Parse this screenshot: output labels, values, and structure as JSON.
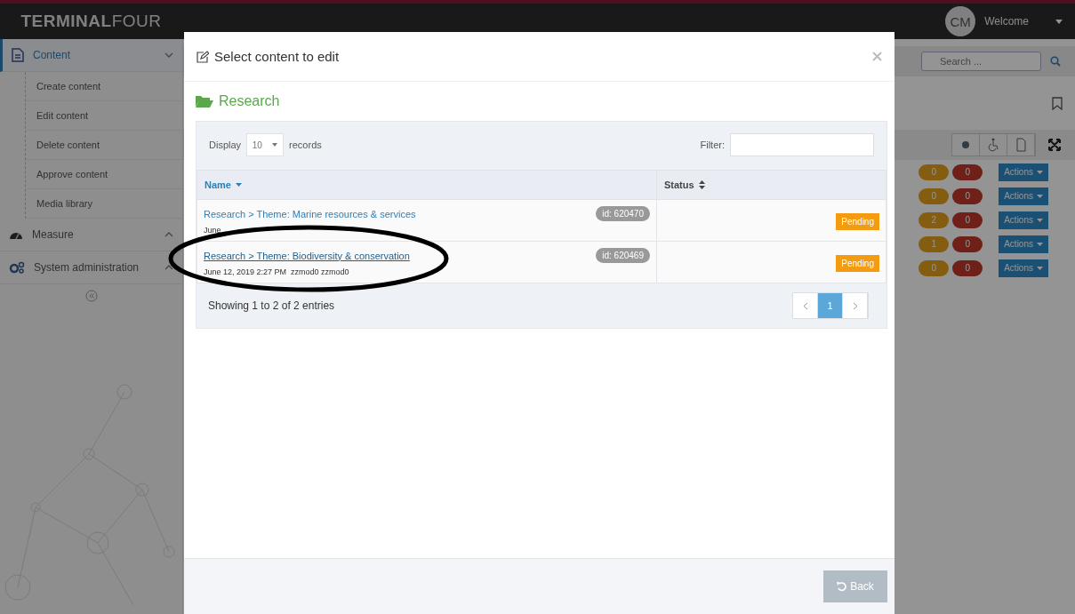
{
  "topbar": {
    "logo_bold": "TERMINAL",
    "logo_light": "FOUR",
    "avatar": "CM",
    "welcome": "Welcome"
  },
  "sidebar": {
    "items": [
      {
        "kind": "content",
        "label": "Content",
        "selected": true,
        "expanded": true,
        "children": [
          "Create content",
          "Edit content",
          "Delete content",
          "Approve content",
          "Media library"
        ]
      },
      {
        "kind": "measure",
        "label": "Measure",
        "selected": false,
        "expanded": false
      },
      {
        "kind": "admin",
        "label": "System administration",
        "selected": false,
        "expanded": false
      }
    ]
  },
  "search": {
    "placeholder": "Search ..."
  },
  "background_rows": [
    {
      "pending": "0",
      "rejected": "0",
      "action": "Actions"
    },
    {
      "pending": "0",
      "rejected": "0",
      "action": "Actions"
    },
    {
      "pending": "2",
      "rejected": "0",
      "action": "Actions"
    },
    {
      "pending": "1",
      "rejected": "0",
      "action": "Actions"
    },
    {
      "pending": "0",
      "rejected": "0",
      "action": "Actions"
    }
  ],
  "modal": {
    "title": "Select content to edit",
    "folder": "Research",
    "display_label": "Display",
    "page_size": "10",
    "records_label": "records",
    "filter_label": "Filter:",
    "columns": [
      {
        "label": "Name",
        "sorted": true
      },
      {
        "label": "Status",
        "sorted": false
      }
    ],
    "rows": [
      {
        "path": "Research > Theme: Marine resources & services",
        "meta": "June",
        "id": "id: 620470",
        "status": "Pending",
        "hovered": false
      },
      {
        "path": "Research > Theme: Biodiversity & conservation",
        "meta": "June 12, 2019 2:27 PM  zzmod0 zzmod0",
        "id": "id: 620469",
        "status": "Pending",
        "hovered": true
      }
    ],
    "summary": "Showing 1 to 2 of 2 entries",
    "pages": [
      {
        "label": "1",
        "selected": true
      }
    ],
    "back": "Back"
  }
}
